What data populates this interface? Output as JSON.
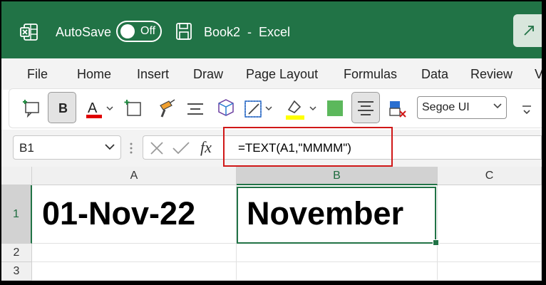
{
  "titlebar": {
    "autosave_label": "AutoSave",
    "autosave_state": "Off",
    "doc_title": "Book2  -  Excel",
    "bg_color": "#217346"
  },
  "menu": {
    "items": [
      "File",
      "Home",
      "Insert",
      "Draw",
      "Page Layout",
      "Formulas",
      "Data",
      "Review",
      "V"
    ]
  },
  "ribbon": {
    "bold_label": "B",
    "font_name": "Segoe UI",
    "font_color": "#e00000",
    "highlight_color": "#ffff00",
    "fill_color": "#5cb85c",
    "icons": [
      "comment-icon",
      "bold-icon",
      "font-color-icon",
      "insert-cell-icon",
      "format-painter-icon",
      "align-center-icon",
      "shapes-icon",
      "borders-icon",
      "highlight-icon",
      "fill-color-icon",
      "center-align-icon",
      "delete-cells-icon",
      "more-icon"
    ]
  },
  "formula_bar": {
    "name_box": "B1",
    "formula": "=TEXT(A1,\"MMMM\")",
    "fx_label": "fx"
  },
  "grid": {
    "columns": [
      "A",
      "B",
      "C"
    ],
    "rows": [
      "1",
      "2",
      "3"
    ],
    "a1": "01-Nov-22",
    "b1": "November",
    "selected_cell": "B1"
  }
}
